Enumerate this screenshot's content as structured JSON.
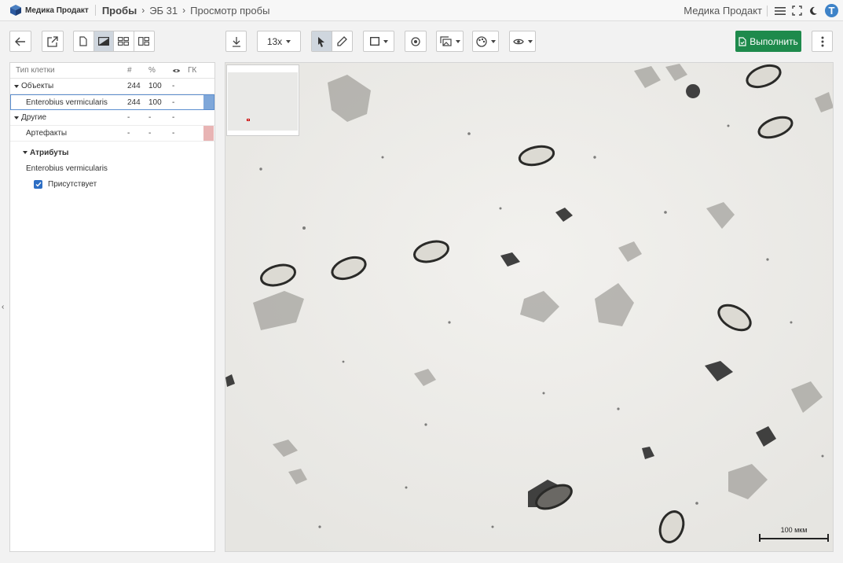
{
  "header": {
    "logo_text": "Медика Продакт",
    "breadcrumbs": [
      "Пробы",
      "ЭБ 31",
      "Просмотр пробы"
    ],
    "company": "Медика Продакт",
    "user_initial": "T"
  },
  "toolbar": {
    "zoom": "13x",
    "run_label": "Выполнить"
  },
  "table": {
    "headers": {
      "name": "Тип клетки",
      "count": "#",
      "percent": "%",
      "gk": "ГК"
    },
    "rows": [
      {
        "name": "Объекты",
        "count": "244",
        "percent": "100",
        "eye": "-",
        "level": 0,
        "color": ""
      },
      {
        "name": "Enterobius vermicularis",
        "count": "244",
        "percent": "100",
        "eye": "-",
        "level": 1,
        "color": "#7fa7d9"
      },
      {
        "name": "Другие",
        "count": "-",
        "percent": "-",
        "eye": "-",
        "level": 0,
        "color": ""
      },
      {
        "name": "Артефакты",
        "count": "-",
        "percent": "-",
        "eye": "-",
        "level": 1,
        "color": "#e8b4b4"
      }
    ]
  },
  "attributes": {
    "title": "Атрибуты",
    "class_name": "Enterobius vermicularis",
    "checkbox_label": "Присутствует",
    "checked": true
  },
  "viewer": {
    "scale_label": "100 мкм"
  }
}
